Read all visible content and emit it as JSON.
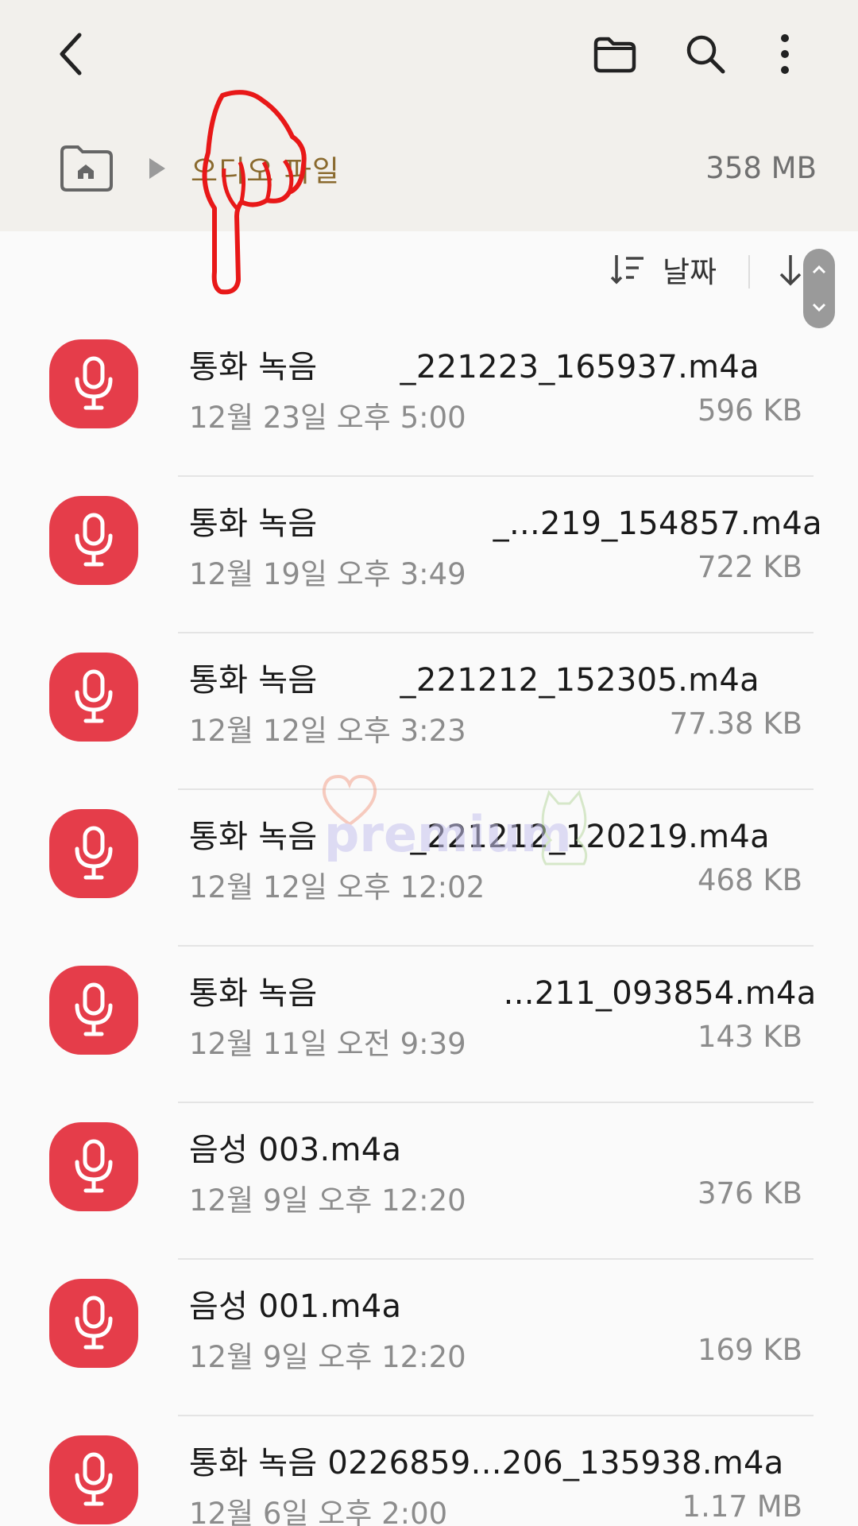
{
  "header": {
    "back_icon": "chevron-left-icon",
    "actions": [
      "folder-icon",
      "search-icon",
      "more-vertical-icon"
    ]
  },
  "breadcrumb": {
    "home_icon": "home-icon",
    "current": "오디오 파일",
    "storage": "358 MB"
  },
  "sort": {
    "label": "날짜",
    "direction_icon": "arrow-down-icon"
  },
  "files": [
    {
      "name": "통화 녹음        _221223_165937.m4a",
      "date": "12월 23일 오후 5:00",
      "size": "596 KB"
    },
    {
      "name": "통화 녹음                 _...219_154857.m4a",
      "date": "12월 19일 오후 3:49",
      "size": "722 KB"
    },
    {
      "name": "통화 녹음        _221212_152305.m4a",
      "date": "12월 12일 오후 3:23",
      "size": "77.38 KB"
    },
    {
      "name": "통화 녹음         _221212_120219.m4a",
      "date": "12월 12일 오후 12:02",
      "size": "468 KB"
    },
    {
      "name": "통화 녹음                  ...211_093854.m4a",
      "date": "12월 11일 오전 9:39",
      "size": "143 KB"
    },
    {
      "name": "음성 003.m4a",
      "date": "12월 9일 오후 12:20",
      "size": "376 KB"
    },
    {
      "name": "음성 001.m4a",
      "date": "12월 9일 오후 12:20",
      "size": "169 KB"
    },
    {
      "name": "통화 녹음 0226859...206_135938.m4a",
      "date": "12월 6일 오후 2:00",
      "size": "1.17 MB"
    }
  ],
  "file_icon": "microphone-icon",
  "colors": {
    "header_bg": "#f2f0ec",
    "accent_red": "#e53d4a",
    "breadcrumb_text": "#8a6a2e"
  },
  "watermark": {
    "text": "premium"
  }
}
